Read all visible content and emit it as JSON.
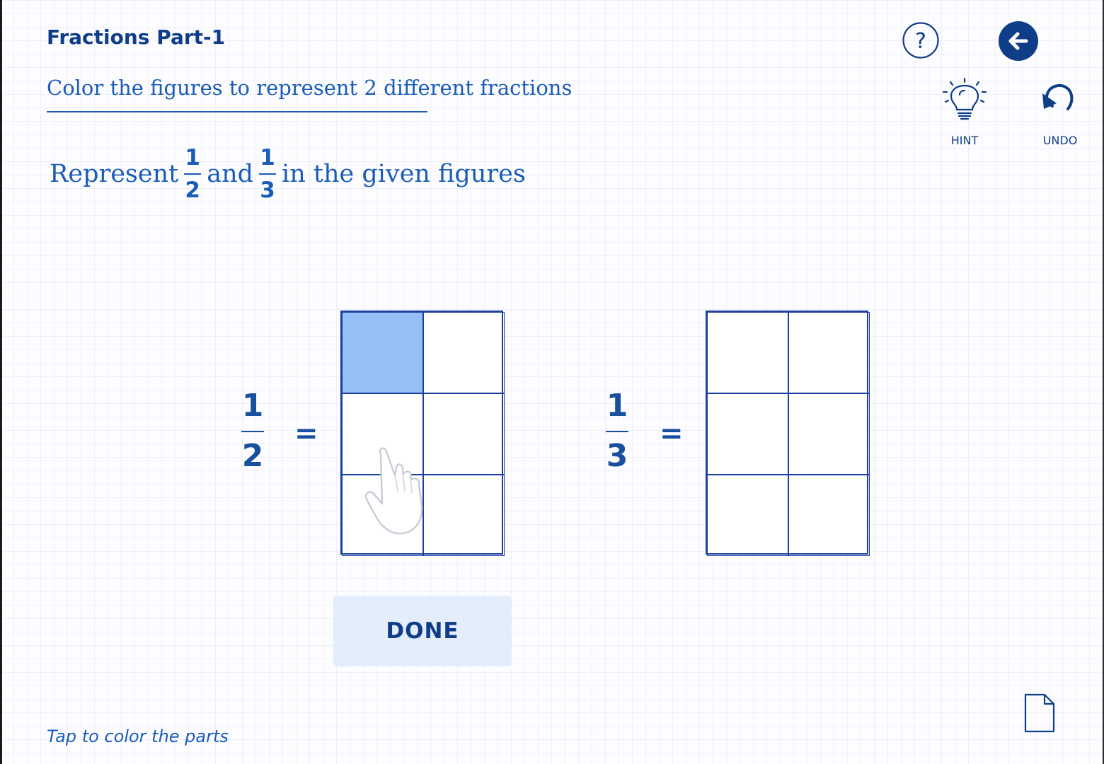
{
  "header": {
    "title": "Fractions Part-1",
    "instruction": "Color the figures to represent 2 different fractions"
  },
  "question": {
    "prefix": "Represent",
    "fraction_a": {
      "numerator": "1",
      "denominator": "2"
    },
    "joiner": "and",
    "fraction_b": {
      "numerator": "1",
      "denominator": "3"
    },
    "suffix": "in the given figures"
  },
  "toolbar": {
    "help_icon": "help-icon",
    "back_icon": "back-arrow-icon",
    "hint_label": "HINT",
    "hint_icon": "lightbulb-icon",
    "undo_label": "UNDO",
    "undo_icon": "undo-icon"
  },
  "figures": [
    {
      "fraction": {
        "numerator": "1",
        "denominator": "2"
      },
      "equals": "=",
      "rows": 3,
      "cols": 2,
      "filled_cells": [
        [
          0,
          0
        ]
      ]
    },
    {
      "fraction": {
        "numerator": "1",
        "denominator": "3"
      },
      "equals": "=",
      "rows": 3,
      "cols": 2,
      "filled_cells": []
    }
  ],
  "actions": {
    "done_label": "DONE"
  },
  "footer": {
    "hint_text": "Tap to color the parts",
    "page_icon": "page-icon"
  },
  "colors": {
    "primary": "#0f3d87",
    "accent": "#1a5cb8",
    "cell_fill": "#97bff7",
    "button_bg": "#e3edfb"
  }
}
